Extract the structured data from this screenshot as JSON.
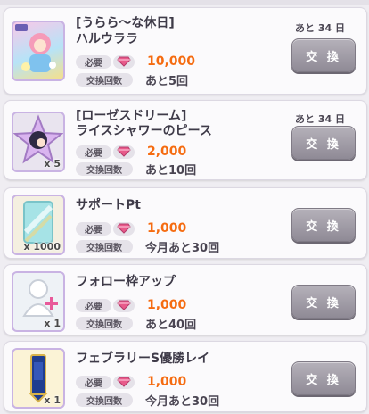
{
  "labels": {
    "required": "必要",
    "exchange_count": "交換回数",
    "exchange_button": "交 換"
  },
  "items": [
    {
      "title_line1": "[うらら～な休日]",
      "title_line2": "ハルウララ",
      "days_left": "あと 34 日",
      "cost": "10,000",
      "remaining": "あと5回",
      "thumb_count": ""
    },
    {
      "title_line1": "[ローゼスドリーム]",
      "title_line2": "ライスシャワーのピース",
      "days_left": "あと 34 日",
      "cost": "2,000",
      "remaining": "あと10回",
      "thumb_count": "x 5"
    },
    {
      "title_line1": "サポートPt",
      "title_line2": "",
      "days_left": "",
      "cost": "1,000",
      "remaining": "今月あと30回",
      "thumb_count": "x 1000"
    },
    {
      "title_line1": "フォロー枠アップ",
      "title_line2": "",
      "days_left": "",
      "cost": "1,000",
      "remaining": "あと40回",
      "thumb_count": "x 1"
    },
    {
      "title_line1": "フェブラリーS優勝レイ",
      "title_line2": "",
      "days_left": "",
      "cost": "1,000",
      "remaining": "今月あと30回",
      "thumb_count": "x 1"
    }
  ],
  "colors": {
    "cost_text": "#f56b10",
    "button_gray": "#a29da8",
    "gem_pink": "#e85a8a"
  },
  "icons": [
    "card-thumbnail-icon",
    "piece-star-icon",
    "support-pt-icon",
    "follow-slot-icon",
    "sash-icon",
    "pink-gem-icon"
  ]
}
